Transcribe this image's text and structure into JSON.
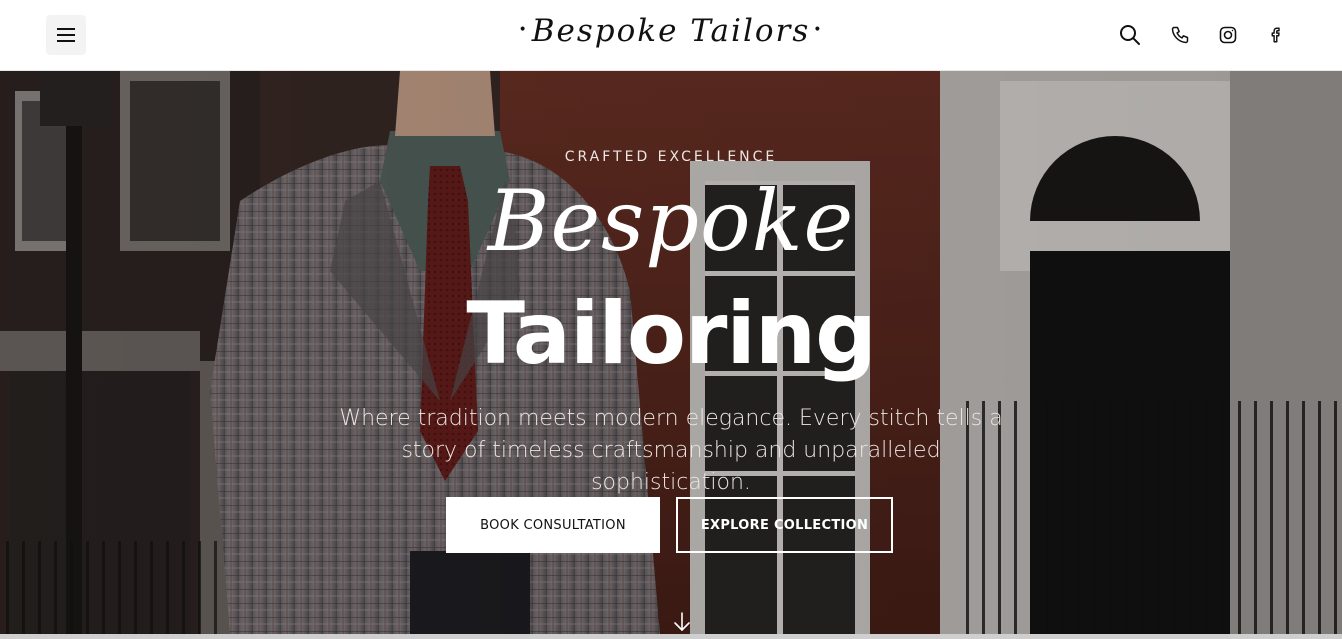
{
  "header": {
    "brand": "Bespoke Tailors",
    "brand_ornament": "•",
    "icons": [
      "menu-icon",
      "search-icon",
      "phone-icon",
      "instagram-icon",
      "facebook-icon"
    ]
  },
  "hero": {
    "eyebrow": "CRAFTED EXCELLENCE",
    "title_script": "Bespoke",
    "title_bold": "Tailoring",
    "subtitle": "Where tradition meets modern elegance. Every stitch tells a story of timeless craftsmanship and unparalleled sophistication.",
    "primary_button": "BOOK CONSULTATION",
    "secondary_button": "EXPLORE COLLECTION",
    "scroll_icon": "arrow-down-icon"
  },
  "colors": {
    "header_bg": "#ffffff",
    "text_dark": "#111111",
    "text_light": "#ffffff",
    "brick": "#7a3528"
  }
}
